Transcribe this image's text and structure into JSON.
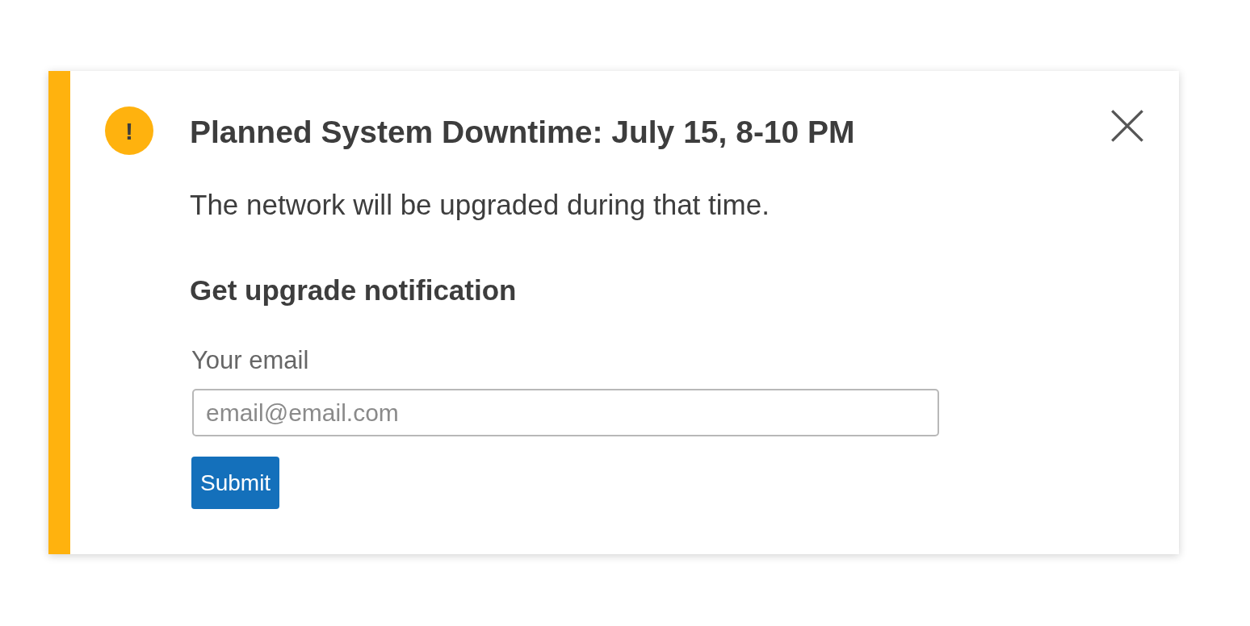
{
  "alert": {
    "icon_glyph": "!",
    "title": "Planned System Downtime: July 15, 8-10 PM",
    "message": "The network will be upgraded during that time."
  },
  "form": {
    "heading": "Get upgrade notification",
    "email_label": "Your email",
    "placeholder": "email@email.com",
    "submit": "Submit"
  }
}
